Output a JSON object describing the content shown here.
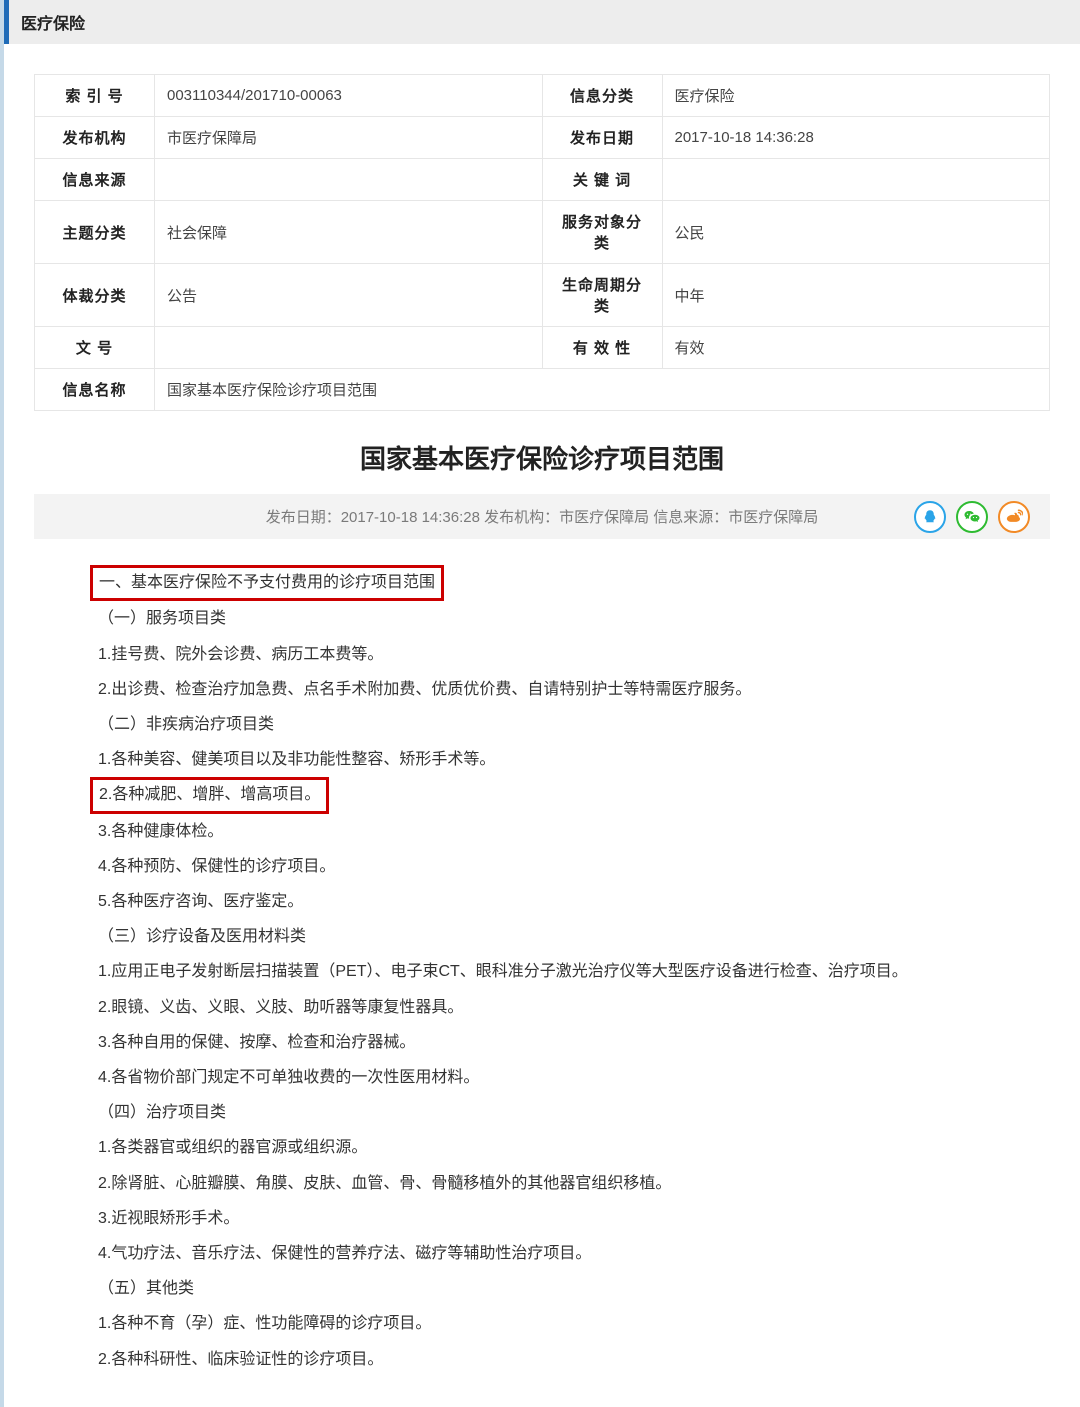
{
  "header": {
    "category": "医疗保险"
  },
  "meta": {
    "rows": [
      {
        "l1": "索 引 号",
        "v1": "003110344/201710-00063",
        "l2": "信息分类",
        "v2": "医疗保险"
      },
      {
        "l1": "发布机构",
        "v1": "市医疗保障局",
        "l2": "发布日期",
        "v2": "2017-10-18 14:36:28"
      },
      {
        "l1": "信息来源",
        "v1": "",
        "l2": "关 键 词",
        "v2": ""
      },
      {
        "l1": "主题分类",
        "v1": "社会保障",
        "l2": "服务对象分类",
        "v2": "公民"
      },
      {
        "l1": "体裁分类",
        "v1": "公告",
        "l2": "生命周期分类",
        "v2": "中年"
      },
      {
        "l1": "文 号",
        "v1": "",
        "l2": "有 效 性",
        "v2": "有效"
      }
    ],
    "name_row": {
      "l": "信息名称",
      "v": "国家基本医疗保险诊疗项目范围"
    }
  },
  "title": "国家基本医疗保险诊疗项目范围",
  "subbar": {
    "text": "发布日期：2017-10-18 14:36:28   发布机构：市医疗保障局   信息来源：市医疗保障局"
  },
  "share": {
    "qq": "QQ",
    "wx": "微信",
    "weibo": "微博"
  },
  "body": {
    "h1": "一、基本医疗保险不予支付费用的诊疗项目范围",
    "s1": "（一）服务项目类",
    "s1_1": "1.挂号费、院外会诊费、病历工本费等。",
    "s1_2": "2.出诊费、检查治疗加急费、点名手术附加费、优质优价费、自请特别护士等特需医疗服务。",
    "s2": "（二）非疾病治疗项目类",
    "s2_1": "1.各种美容、健美项目以及非功能性整容、矫形手术等。",
    "s2_2": "2.各种减肥、增胖、增高项目。",
    "s2_3": "3.各种健康体检。",
    "s2_4": "4.各种预防、保健性的诊疗项目。",
    "s2_5": "5.各种医疗咨询、医疗鉴定。",
    "s3": "（三）诊疗设备及医用材料类",
    "s3_1": "1.应用正电子发射断层扫描装置（PET）、电子束CT、眼科准分子激光治疗仪等大型医疗设备进行检查、治疗项目。",
    "s3_2": "2.眼镜、义齿、义眼、义肢、助听器等康复性器具。",
    "s3_3": "3.各种自用的保健、按摩、检查和治疗器械。",
    "s3_4": "4.各省物价部门规定不可单独收费的一次性医用材料。",
    "s4": "（四）治疗项目类",
    "s4_1": "1.各类器官或组织的器官源或组织源。",
    "s4_2": "2.除肾脏、心脏瓣膜、角膜、皮肤、血管、骨、骨髓移植外的其他器官组织移植。",
    "s4_3": "3.近视眼矫形手术。",
    "s4_4": "4.气功疗法、音乐疗法、保健性的营养疗法、磁疗等辅助性治疗项目。",
    "s5": "（五）其他类",
    "s5_1": "1.各种不育（孕）症、性功能障碍的诊疗项目。",
    "s5_2": "2.各种科研性、临床验证性的诊疗项目。"
  }
}
